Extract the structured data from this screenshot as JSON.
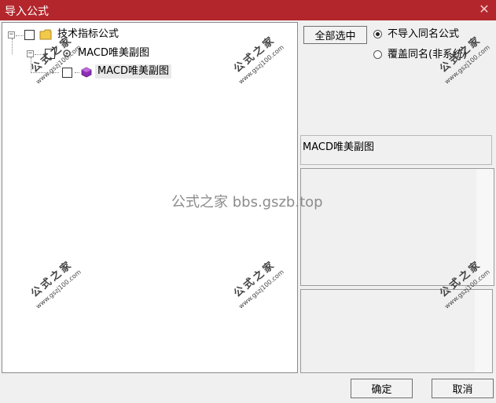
{
  "window": {
    "title": "导入公式",
    "close_glyph": "✕"
  },
  "tree": {
    "root_label": "技术指标公式",
    "group_label": "MACD唯美副图",
    "leaf_label": "MACD唯美副图",
    "expander_minus": "−"
  },
  "options": {
    "select_all_label": "全部选中",
    "radio_no_import": "不导入同名公式",
    "radio_overwrite": "覆盖同名(非系统)",
    "selected_radio": "no_import"
  },
  "detail": {
    "formula_name": "MACD唯美副图"
  },
  "footer": {
    "ok_label": "确定",
    "cancel_label": "取消"
  },
  "watermark": {
    "text": "公式之家 bbs.gszb.top",
    "stamp_title": "公式之家",
    "stamp_url": "www.gszj100.com"
  },
  "colors": {
    "title_bar": "#b3262c",
    "folder": "#f3c94a",
    "formula_icon": "#8b2fb4"
  }
}
